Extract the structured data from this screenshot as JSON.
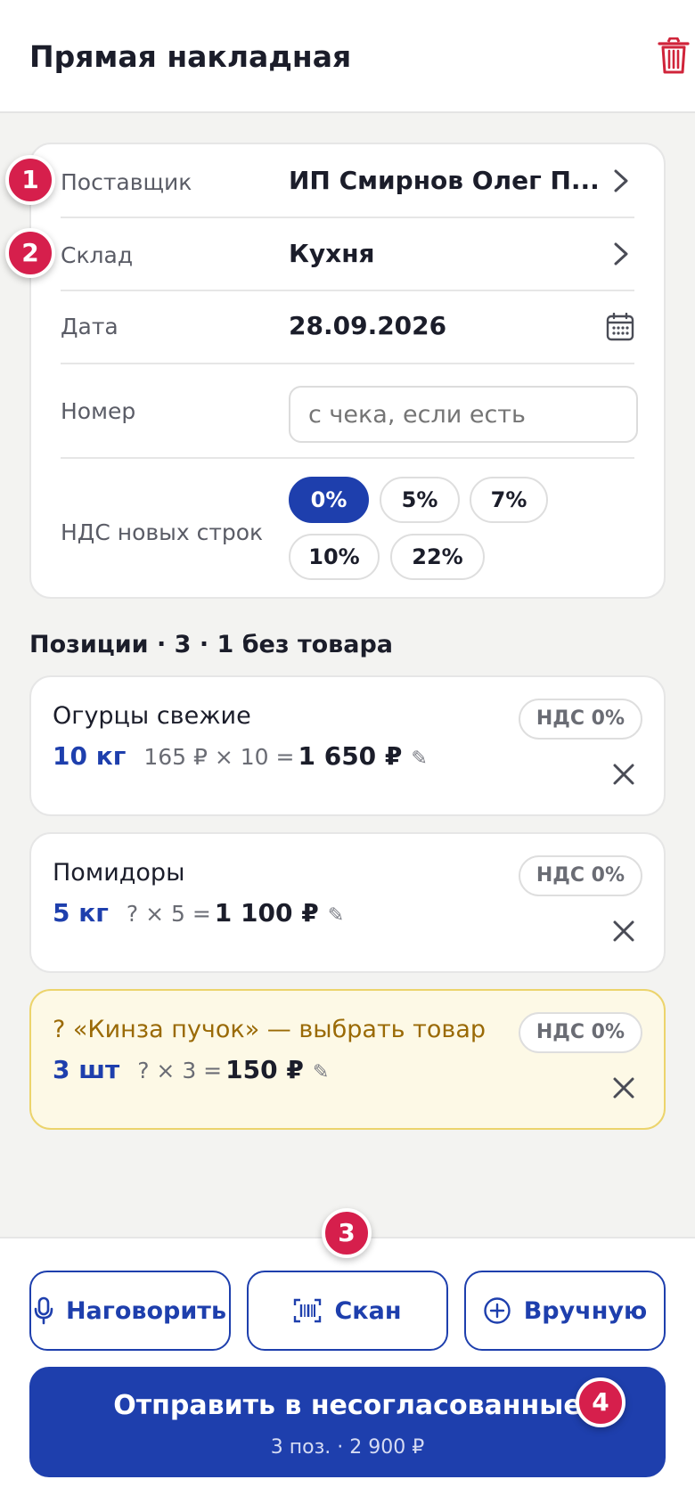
{
  "header": {
    "title": "Прямая накладная"
  },
  "form": {
    "supplier_label": "Поставщик",
    "supplier_value": "ИП Смирнов Олег П...",
    "warehouse_label": "Склад",
    "warehouse_value": "Кухня",
    "date_label": "Дата",
    "date_value": "28.09.2026",
    "number_label": "Номер",
    "number_placeholder": "с чека, если есть",
    "vat_label": "НДС новых строк",
    "vat_options": [
      "0%",
      "5%",
      "7%",
      "10%",
      "22%"
    ],
    "vat_selected": "0%"
  },
  "positions": {
    "title": "Позиции · 3 · 1 без товара",
    "items": [
      {
        "name": "Огурцы свежие",
        "qty": "10 кг",
        "calc": "165 ₽ × 10 =",
        "sum": "1 650 ₽",
        "nds": "НДС 0%"
      },
      {
        "name": "Помидоры",
        "qty": "5 кг",
        "calc": "? × 5 =",
        "sum": "1 100 ₽",
        "nds": "НДС 0%"
      },
      {
        "name": "? «Кинза пучок» — выбрать товар",
        "qty": "3 шт",
        "calc": "? × 3 =",
        "sum": "150 ₽",
        "nds": "НДС 0%",
        "needs_product": true
      }
    ]
  },
  "actions": {
    "voice": "Наговорить",
    "scan": "Скан",
    "manual": "Вручную",
    "submit_label": "Отправить в несогласованные",
    "submit_sub": "3 поз. · 2 900 ₽"
  },
  "badges": [
    "1",
    "2",
    "3",
    "4"
  ],
  "colors": {
    "accent": "#1e3fad",
    "badge": "#d61f4c",
    "warning_bg": "#fdf9e6",
    "warning_text": "#9a6a06",
    "danger": "#d0243a"
  },
  "icons": [
    "trash-icon",
    "chevron-right-icon",
    "calendar-icon",
    "close-icon",
    "edit-icon",
    "microphone-icon",
    "barcode-icon",
    "plus-circle-icon"
  ]
}
